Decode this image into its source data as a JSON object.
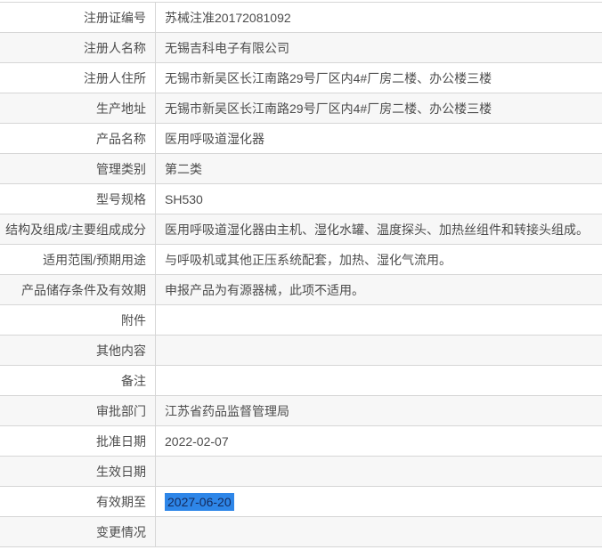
{
  "table": {
    "rows": [
      {
        "label": "注册证编号",
        "value": "苏械注准20172081092"
      },
      {
        "label": "注册人名称",
        "value": "无锡吉科电子有限公司"
      },
      {
        "label": "注册人住所",
        "value": "无锡市新吴区长江南路29号厂区内4#厂房二楼、办公楼三楼"
      },
      {
        "label": "生产地址",
        "value": "无锡市新吴区长江南路29号厂区内4#厂房二楼、办公楼三楼"
      },
      {
        "label": "产品名称",
        "value": "医用呼吸道湿化器"
      },
      {
        "label": "管理类别",
        "value": "第二类"
      },
      {
        "label": "型号规格",
        "value": "SH530"
      },
      {
        "label": "结构及组成/主要组成成分",
        "value": "医用呼吸道湿化器由主机、湿化水罐、温度探头、加热丝组件和转接头组成。"
      },
      {
        "label": "适用范围/预期用途",
        "value": "与呼吸机或其他正压系统配套，加热、湿化气流用。"
      },
      {
        "label": "产品储存条件及有效期",
        "value": "申报产品为有源器械，此项不适用。"
      },
      {
        "label": "附件",
        "value": ""
      },
      {
        "label": "其他内容",
        "value": ""
      },
      {
        "label": "备注",
        "value": ""
      },
      {
        "label": "审批部门",
        "value": "江苏省药品监督管理局"
      },
      {
        "label": "批准日期",
        "value": "2022-02-07"
      },
      {
        "label": "生效日期",
        "value": ""
      },
      {
        "label": "有效期至",
        "value": "2027-06-20",
        "highlighted": true
      },
      {
        "label": "变更情况",
        "value": ""
      }
    ]
  },
  "colors": {
    "border": "#d6d6d6",
    "alt_row_bg": "#f7f7f7",
    "text": "#4c4c4c",
    "selection_bg": "#2e86e8",
    "selection_text": "#142a5c"
  }
}
